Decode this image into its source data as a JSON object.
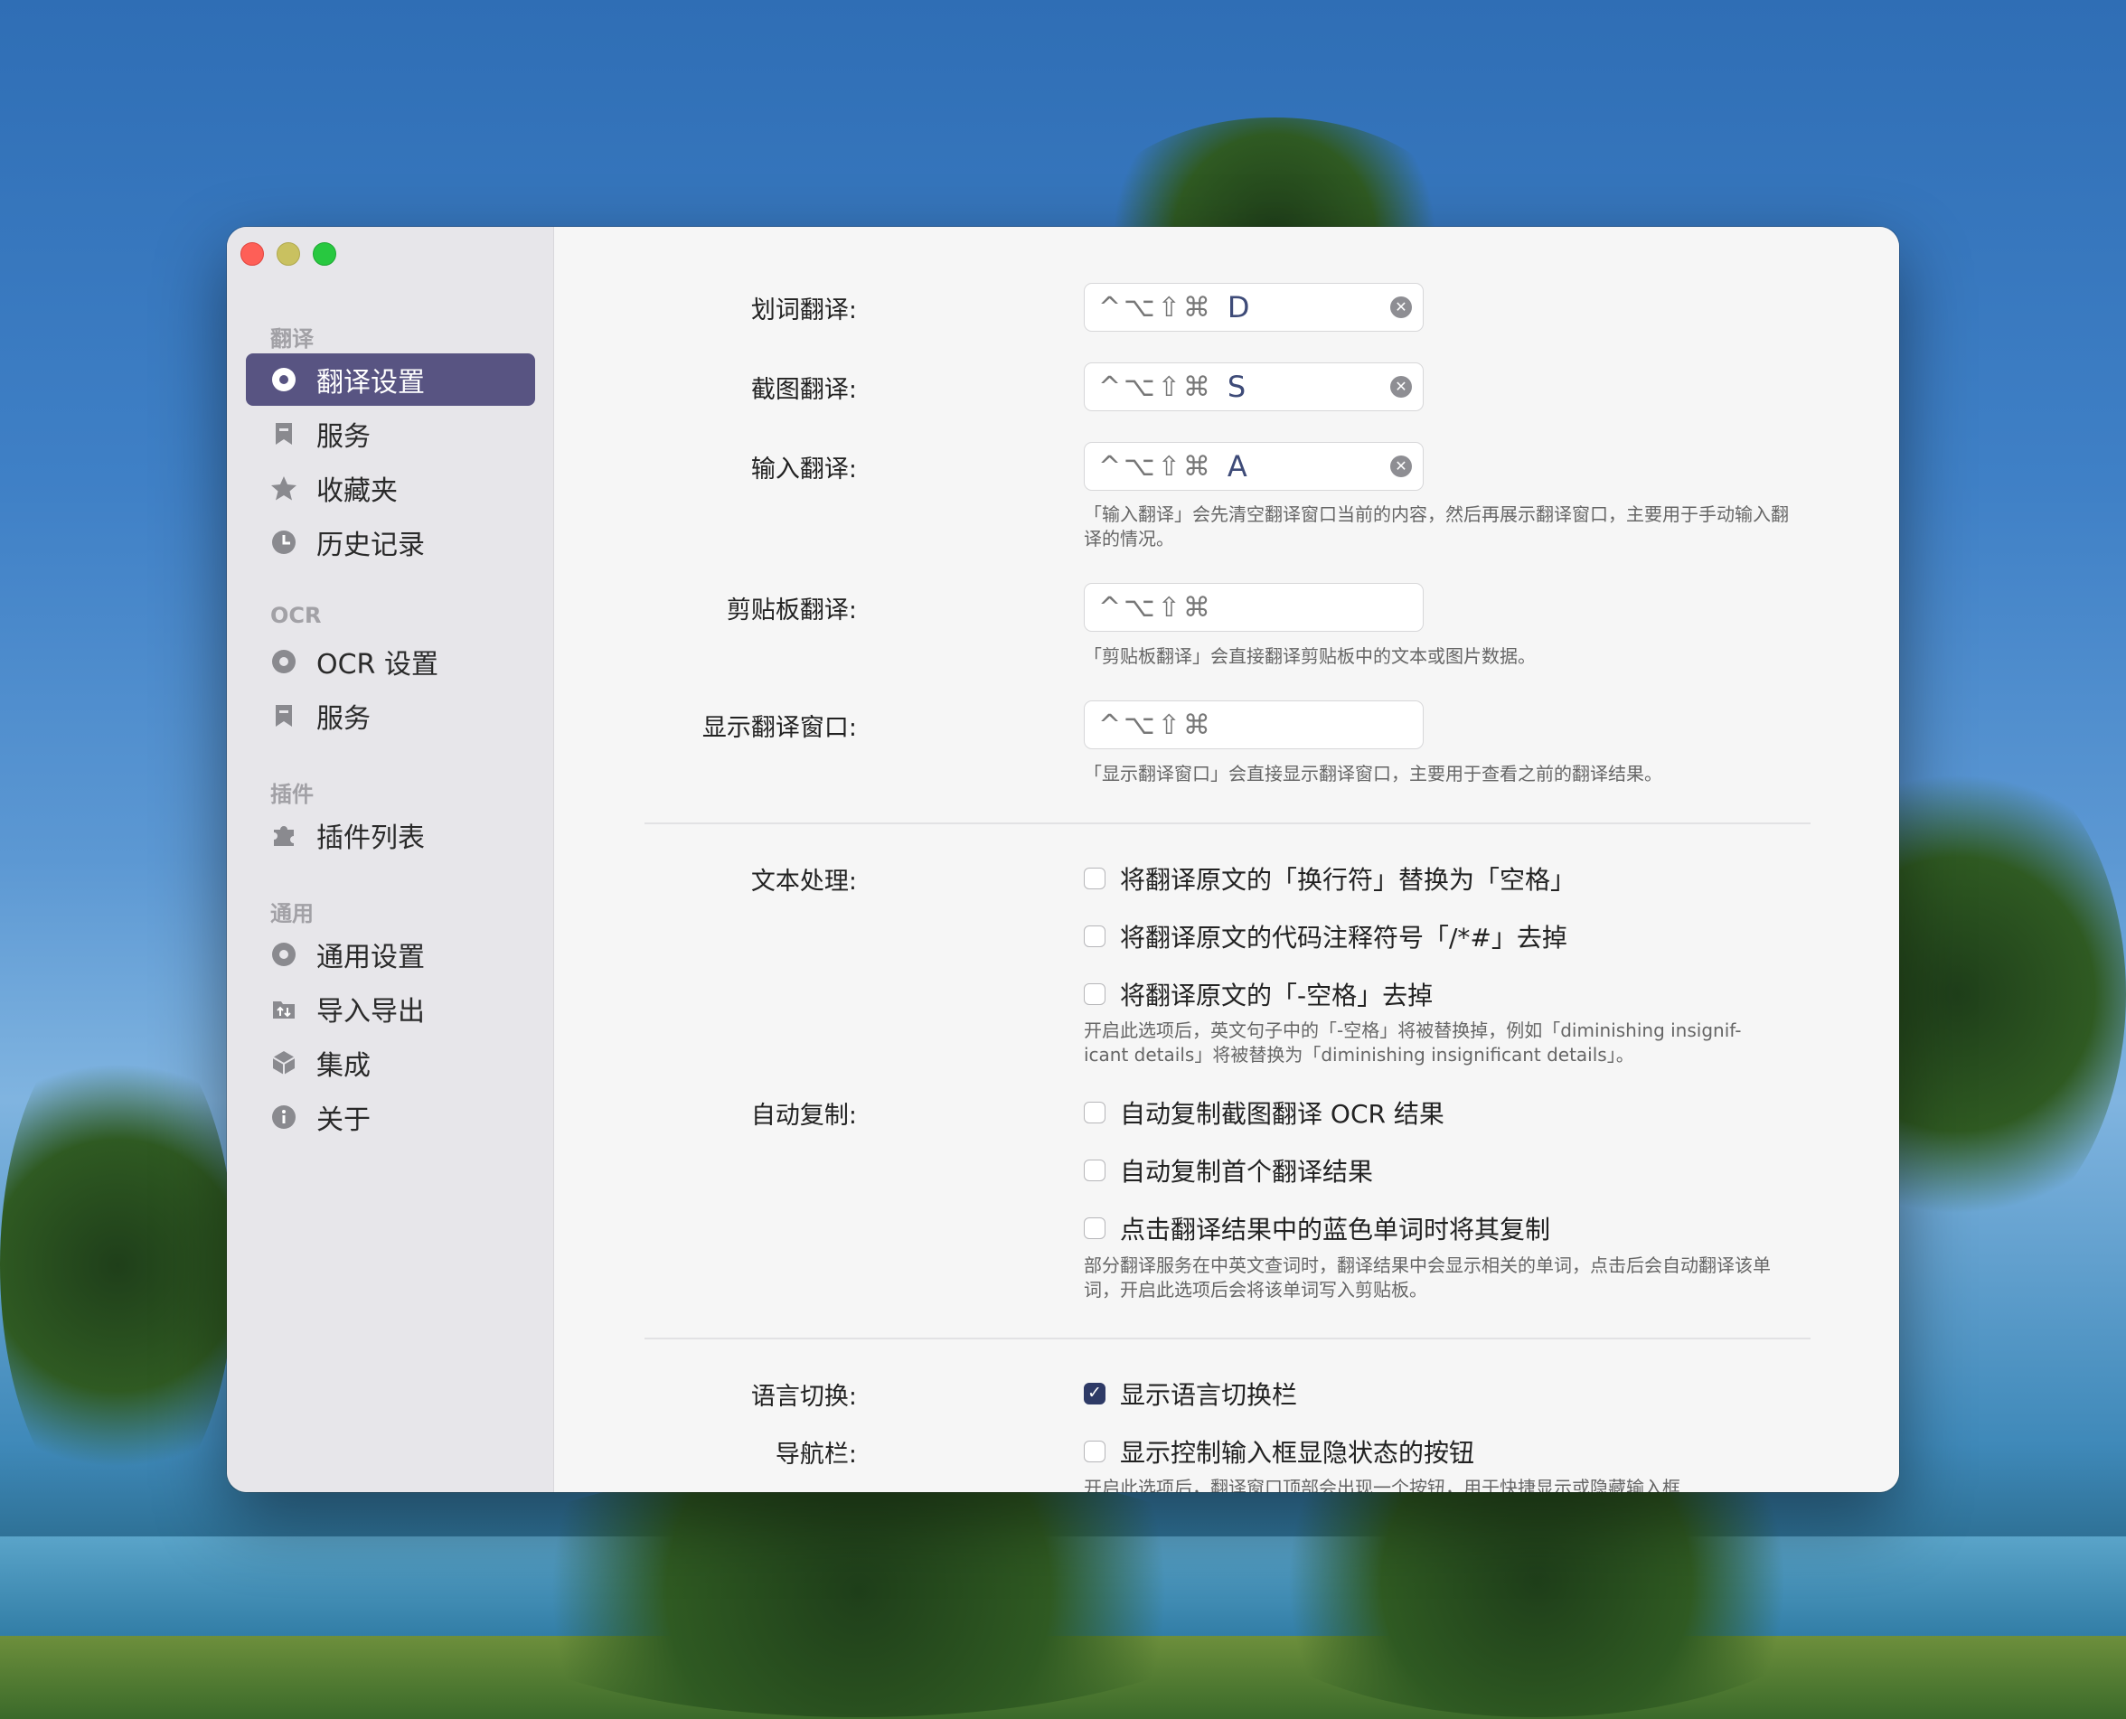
{
  "sidebar": {
    "sections": [
      {
        "title": "翻译",
        "items": [
          {
            "label": "翻译设置",
            "icon": "gear-icon",
            "active": true
          },
          {
            "label": "服务",
            "icon": "bookmark-icon",
            "active": false
          },
          {
            "label": "收藏夹",
            "icon": "star-icon",
            "active": false
          },
          {
            "label": "历史记录",
            "icon": "clock-icon",
            "active": false
          }
        ]
      },
      {
        "title": "OCR",
        "items": [
          {
            "label": "OCR 设置",
            "icon": "gear-icon",
            "active": false
          },
          {
            "label": "服务",
            "icon": "bookmark-icon",
            "active": false
          }
        ]
      },
      {
        "title": "插件",
        "items": [
          {
            "label": "插件列表",
            "icon": "puzzle-icon",
            "active": false
          }
        ]
      },
      {
        "title": "通用",
        "items": [
          {
            "label": "通用设置",
            "icon": "gear-icon",
            "active": false
          },
          {
            "label": "导入导出",
            "icon": "import-export-icon",
            "active": false
          },
          {
            "label": "集成",
            "icon": "cube-icon",
            "active": false
          },
          {
            "label": "关于",
            "icon": "info-icon",
            "active": false
          }
        ]
      }
    ]
  },
  "shortcuts": [
    {
      "label": "划词翻译:",
      "modifiers": "^⌥⇧⌘",
      "key": "D",
      "hint": ""
    },
    {
      "label": "截图翻译:",
      "modifiers": "^⌥⇧⌘",
      "key": "S",
      "hint": ""
    },
    {
      "label": "输入翻译:",
      "modifiers": "^⌥⇧⌘",
      "key": "A",
      "hint": "「输入翻译」会先清空翻译窗口当前的内容，然后再展示翻译窗口，主要用于手动输入翻译的情况。"
    },
    {
      "label": "剪贴板翻译:",
      "modifiers": "^⌥⇧⌘",
      "key": "",
      "hint": "「剪贴板翻译」会直接翻译剪贴板中的文本或图片数据。"
    },
    {
      "label": "显示翻译窗口:",
      "modifiers": "^⌥⇧⌘",
      "key": "",
      "hint": "「显示翻译窗口」会直接显示翻译窗口，主要用于查看之前的翻译结果。"
    }
  ],
  "text_processing": {
    "label": "文本处理:",
    "options": [
      {
        "text": "将翻译原文的「换行符」替换为「空格」",
        "checked": false
      },
      {
        "text": "将翻译原文的代码注释符号「/*#」去掉",
        "checked": false
      },
      {
        "text": "将翻译原文的「-空格」去掉",
        "checked": false
      }
    ],
    "hint": "开启此选项后，英文句子中的「-空格」将被替换掉，例如「diminishing insignif- icant details」将被替换为「diminishing insignificant details」。"
  },
  "auto_copy": {
    "label": "自动复制:",
    "options": [
      {
        "text": "自动复制截图翻译 OCR 结果",
        "checked": false
      },
      {
        "text": "自动复制首个翻译结果",
        "checked": false
      },
      {
        "text": "点击翻译结果中的蓝色单词时将其复制",
        "checked": false
      }
    ],
    "hint": "部分翻译服务在中英文查词时，翻译结果中会显示相关的单词，点击后会自动翻译该单词，开启此选项后会将该单词写入剪贴板。"
  },
  "language_switch": {
    "label": "语言切换:",
    "text": "显示语言切换栏",
    "checked": true
  },
  "nav_bar": {
    "label": "导航栏:",
    "text": "显示控制输入框显隐状态的按钮",
    "checked": false,
    "hint": "开启此选项后，翻译窗口顶部会出现一个按钮，用于快捷显示或隐藏输入框"
  },
  "colors": {
    "accent": "#585482",
    "checkbox_checked": "#2e3a66"
  }
}
